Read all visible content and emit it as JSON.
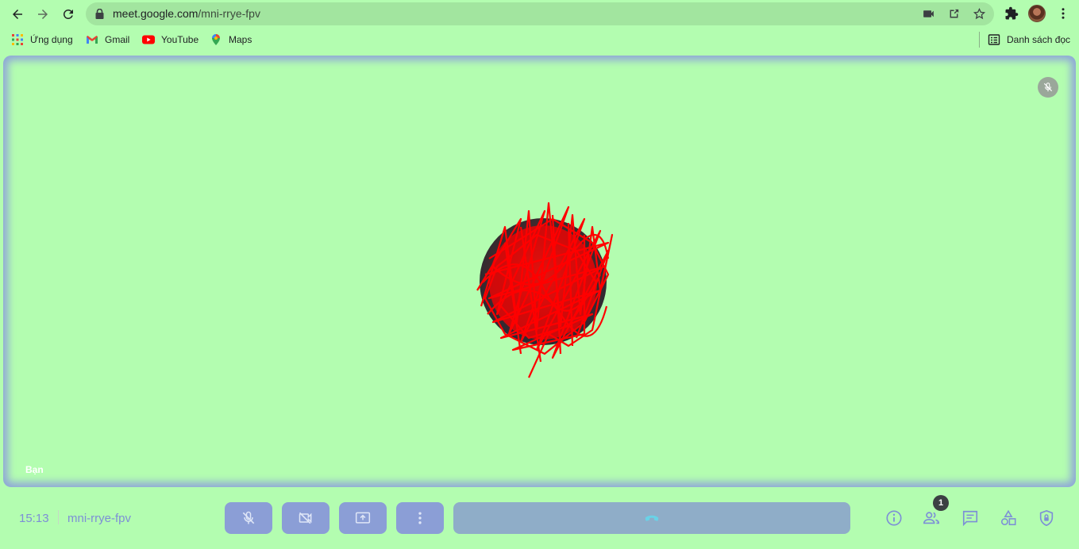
{
  "browser": {
    "url_host": "meet.google.com",
    "url_path": "/mni-rrye-fpv",
    "icons": [
      "back-arrow-icon",
      "forward-arrow-icon",
      "reload-icon",
      "lock-icon",
      "camera-icon",
      "share-icon",
      "star-icon",
      "extensions-icon",
      "kebab-menu-icon"
    ]
  },
  "bookmarks": {
    "apps_label": "Ứng dụng",
    "gmail_label": "Gmail",
    "youtube_label": "YouTube",
    "maps_label": "Maps",
    "reading_list_label": "Danh sách đọc"
  },
  "meet": {
    "self_label": "Bạn",
    "clock": "15:13",
    "meeting_code": "mni-rrye-fpv",
    "participants_count": "1",
    "controls": [
      "mic-off-button",
      "camera-off-button",
      "present-button",
      "more-options-button",
      "leave-call-button"
    ],
    "side_controls": [
      "meeting-details-button",
      "people-button",
      "chat-button",
      "activities-button",
      "host-controls-button"
    ]
  },
  "colors": {
    "background": "#b3fdb0",
    "omnibox": "#a2e59f",
    "control_button": "#8b9ed6",
    "leave_button": "#8fadc8",
    "accent_text": "#7d8fd6",
    "tile_border": "#8fa6d8",
    "scribble": "#ff0000"
  }
}
